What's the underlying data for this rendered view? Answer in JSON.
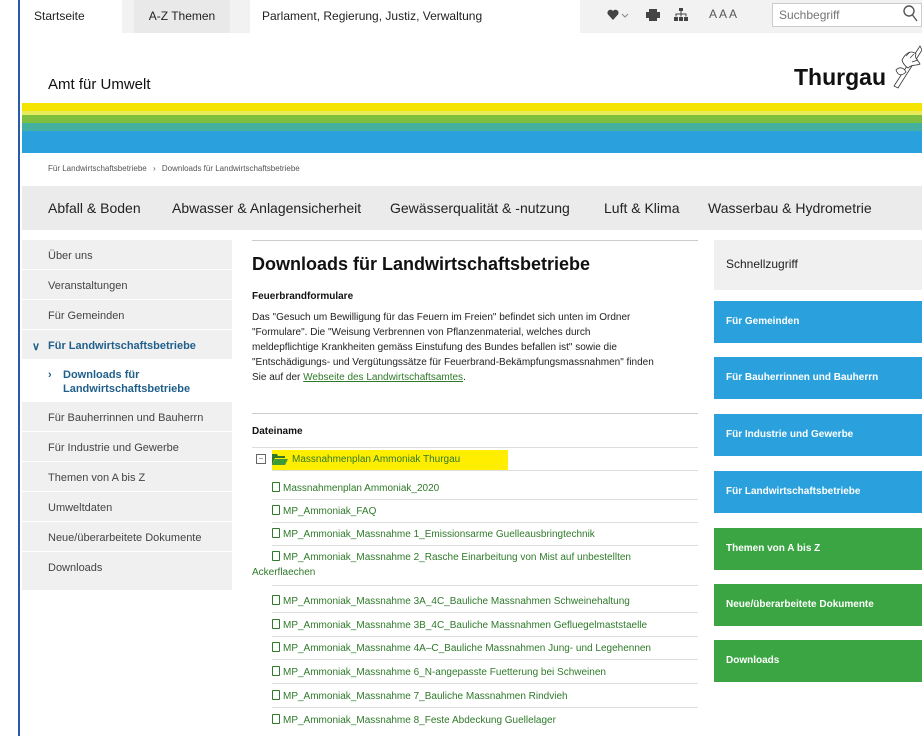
{
  "topbar": {
    "tabs": [
      "Startseite tg.ch",
      "A-Z Themen",
      "Parlament, Regierung, Justiz, Verwaltung"
    ],
    "font_size_label": "A A A",
    "search_placeholder": "Suchbegriff"
  },
  "header": {
    "department": "Amt für Umwelt",
    "canton": "Thurgau"
  },
  "colors": {
    "stripe_yellow": "#f5e400",
    "stripe_yellow_light": "#e6eb5a",
    "stripe_green": "#7fbf3f",
    "stripe_teal": "#43b0a0",
    "stripe_blue": "#2aa1dc",
    "quick_blue": "#2aa1dc",
    "quick_green": "#3aa542",
    "link_green": "#2f7a2a",
    "highlight": "#ffee00"
  },
  "breadcrumb": [
    "Für Landwirtschaftsbetriebe",
    "›",
    "Downloads für Landwirtschaftsbetriebe"
  ],
  "mainnav": [
    "Abfall & Boden",
    "Abwasser & Anlagensicherheit",
    "Gewässerqualität & -nutzung",
    "Luft & Klima",
    "Wasserbau & Hydrometrie"
  ],
  "sidebar": {
    "items": [
      "Über uns",
      "Veranstaltungen",
      "Für Gemeinden",
      "Für Landwirtschaftsbetriebe",
      "Downloads für",
      "Landwirtschaftsbetriebe",
      "Für Bauherrinnen und Bauherrn",
      "Für Industrie und Gewerbe",
      "Themen von A bis Z",
      "Umweltdaten",
      "Neue/überarbeitete Dokumente",
      "Downloads"
    ],
    "expanded_marker": "∨",
    "sub_marker": "›"
  },
  "content": {
    "title": "Downloads für Landwirtschaftsbetriebe",
    "subtitle": "Feuerbrandformulare",
    "para_lines": [
      "Das \"Gesuch um Bewilligung für das Feuern im Freien\" befindet sich unten im Ordner",
      "\"Formulare\". Die \"Weisung Verbrennen von Pflanzenmaterial, welches durch",
      "meldepflichtige Krankheiten gemäss Einstufung des Bundes befallen ist\" sowie die",
      "\"Entschädigungs- und Vergütungssätze für Feuerbrand-Bekämpfungsmassnahmen\" finden",
      "Sie auf der "
    ],
    "para_link": "Webseite des Landwirtschaftsamtes",
    "para_end": ".",
    "table_header": "Dateiname",
    "folder": "Massnahmenplan Ammoniak Thurgau",
    "files": [
      "Massnahmenplan Ammoniak_2020",
      "MP_Ammoniak_FAQ",
      "MP_Ammoniak_Massnahme 1_Emissionsarme Guelleausbringtechnik",
      "MP_Ammoniak_Massnahme 2_Rasche Einarbeitung von Mist auf unbestellten",
      "Ackerflaechen",
      "MP_Ammoniak_Massnahme 3A_4C_Bauliche Massnahmen Schweinehaltung",
      "MP_Ammoniak_Massnahme 3B_4C_Bauliche Massnahmen Gefluegelmaststaelle",
      "MP_Ammoniak_Massnahme 4A–C_Bauliche Massnahmen Jung- und Legehennen",
      "MP_Ammoniak_Massnahme 6_N-angepasste Fuetterung bei Schweinen",
      "MP_Ammoniak_Massnahme 7_Bauliche Massnahmen Rindvieh",
      "MP_Ammoniak_Massnahme 8_Feste Abdeckung Guellelager"
    ]
  },
  "quick": {
    "title": "Schnellzugriff",
    "buttons": [
      "Für Gemeinden",
      "Für Bauherrinnen und Bauherrn",
      "Für Industrie und Gewerbe",
      "Für Landwirtschaftsbetriebe",
      "Themen von A bis Z",
      "Neue/überarbeitete Dokumente",
      "Downloads"
    ]
  }
}
